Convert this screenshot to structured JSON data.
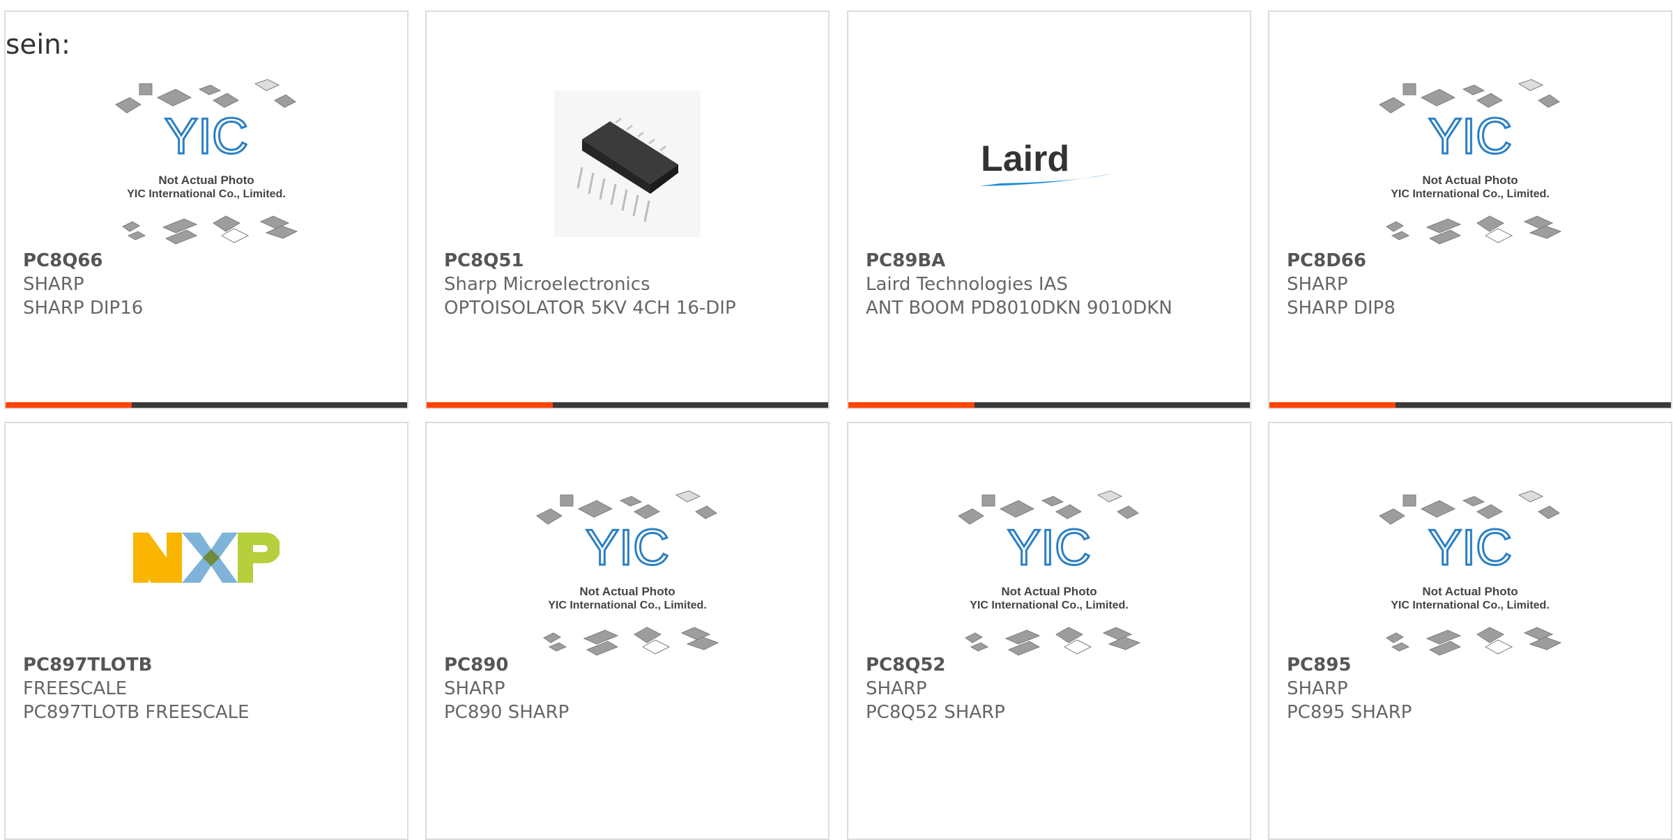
{
  "lead_text": "sein:",
  "colors": {
    "accent": "#ff4406",
    "bar_dark": "#3a3a3a"
  },
  "placeholder": {
    "line1": "Not Actual Photo",
    "line2": "YIC International Co., Limited.",
    "brand": "YIC"
  },
  "logos": {
    "laird": "Laird",
    "nxp": [
      "N",
      "X",
      "P"
    ]
  },
  "products": [
    {
      "part": "PC8Q66",
      "maker": "SHARP",
      "desc": "SHARP DIP16",
      "image": "placeholder"
    },
    {
      "part": "PC8Q51",
      "maker": "Sharp Microelectronics",
      "desc": "OPTOISOLATOR 5KV 4CH 16-DIP",
      "image": "dip-chip"
    },
    {
      "part": "PC89BA",
      "maker": "Laird Technologies IAS",
      "desc": "ANT BOOM PD8010DKN 9010DKN",
      "image": "laird-logo"
    },
    {
      "part": "PC8D66",
      "maker": "SHARP",
      "desc": "SHARP DIP8",
      "image": "placeholder"
    },
    {
      "part": "PC897TLOTB",
      "maker": "FREESCALE",
      "desc": "PC897TLOTB FREESCALE",
      "image": "nxp-logo"
    },
    {
      "part": "PC890",
      "maker": "SHARP",
      "desc": "PC890 SHARP",
      "image": "placeholder"
    },
    {
      "part": "PC8Q52",
      "maker": "SHARP",
      "desc": "PC8Q52 SHARP",
      "image": "placeholder"
    },
    {
      "part": "PC895",
      "maker": "SHARP",
      "desc": "PC895 SHARP",
      "image": "placeholder"
    }
  ]
}
